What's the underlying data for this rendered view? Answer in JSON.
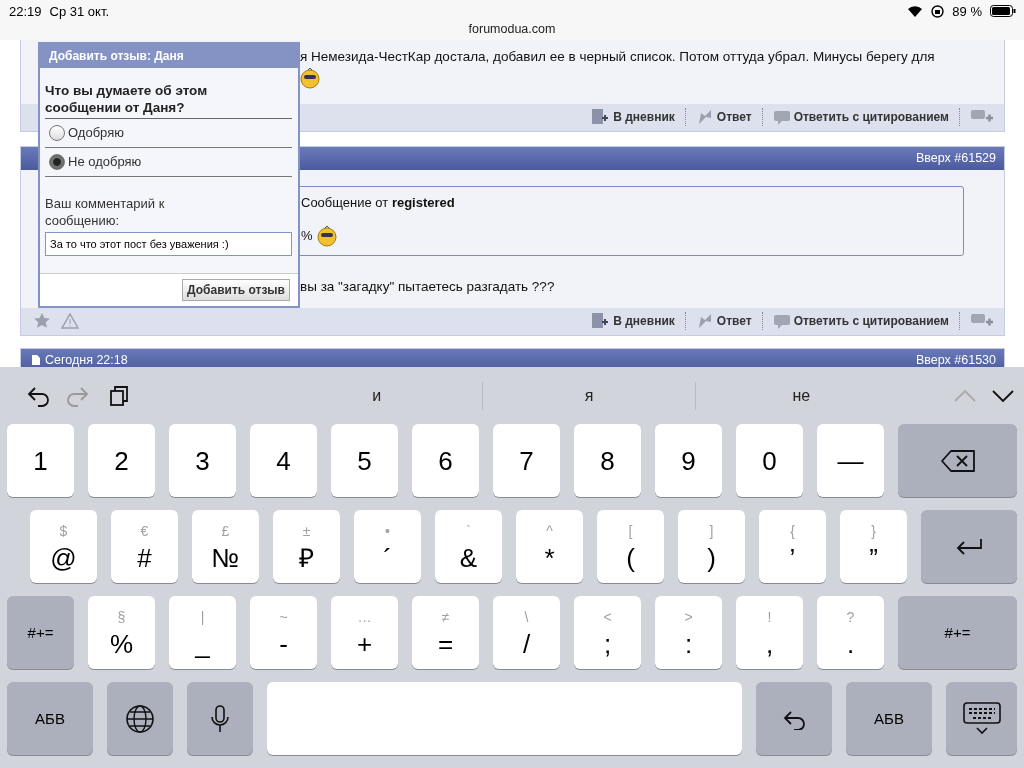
{
  "status_bar": {
    "time": "22:19",
    "date": "Ср 31 окт.",
    "battery": "89 %"
  },
  "address_bar": {
    "url": "forumodua.com"
  },
  "posts": [
    {
      "text": "я Немезида-ЧестКар достала, добавил ее в черный список. Потом оттуда убрал. Минусы берегу для",
      "smiley": true,
      "footer_left_icons": false,
      "actions": [
        "В дневник",
        "Ответ",
        "Ответить с цитированием"
      ]
    },
    {
      "header": {
        "link": "Вверх #61529"
      },
      "quote": {
        "title": "Сообщение от ",
        "author": "registered",
        "text": "%"
      },
      "text": "вы за \"загадку\" пытаетесь разгадать ???",
      "smiley": false,
      "footer_left_icons": true,
      "actions": [
        "В дневник",
        "Ответ",
        "Ответить с цитированием"
      ]
    },
    {
      "header": {
        "date": "Сегодня 22:18",
        "link": "Вверх #61530"
      }
    }
  ],
  "dialog": {
    "title": "Добавить отзыв: Даня",
    "question": "Что вы думаете об этом сообщении от Даня?",
    "options": [
      {
        "label": "Одобряю",
        "selected": false
      },
      {
        "label": "Не одобряю",
        "selected": true
      }
    ],
    "comment_label": "Ваш комментарий к сообщению:",
    "comment": "За то что этот пост без уважения :)",
    "submit": "Добавить отзыв"
  },
  "suggestions": [
    "и",
    "я",
    "не"
  ],
  "keyboard": [
    [
      {
        "kind": "char",
        "label": "1"
      },
      {
        "kind": "char",
        "label": "2"
      },
      {
        "kind": "char",
        "label": "3"
      },
      {
        "kind": "char",
        "label": "4"
      },
      {
        "kind": "char",
        "label": "5"
      },
      {
        "kind": "char",
        "label": "6"
      },
      {
        "kind": "char",
        "label": "7"
      },
      {
        "kind": "char",
        "label": "8"
      },
      {
        "kind": "char",
        "label": "9"
      },
      {
        "kind": "char",
        "label": "0"
      },
      {
        "kind": "char",
        "label": "—"
      },
      {
        "kind": "delete"
      }
    ],
    [
      {
        "kind": "char",
        "label": "@",
        "alt": "$"
      },
      {
        "kind": "char",
        "label": "#",
        "alt": "€"
      },
      {
        "kind": "char",
        "label": "№",
        "alt": "£"
      },
      {
        "kind": "char",
        "label": "₽",
        "alt": "±"
      },
      {
        "kind": "char",
        "label": "´",
        "alt": "•"
      },
      {
        "kind": "char",
        "label": "&",
        "alt": "`"
      },
      {
        "kind": "char",
        "label": "*",
        "alt": "^"
      },
      {
        "kind": "char",
        "label": "(",
        "alt": "["
      },
      {
        "kind": "char",
        "label": ")",
        "alt": "]"
      },
      {
        "kind": "char",
        "label": "’",
        "alt": "{"
      },
      {
        "kind": "char",
        "label": "”",
        "alt": "}"
      },
      {
        "kind": "return"
      }
    ],
    [
      {
        "kind": "function",
        "label": "#+="
      },
      {
        "kind": "char",
        "label": "%",
        "alt": "§"
      },
      {
        "kind": "char",
        "label": "_",
        "alt": "|"
      },
      {
        "kind": "char",
        "label": "-",
        "alt": "~"
      },
      {
        "kind": "char",
        "label": "+",
        "alt": "…"
      },
      {
        "kind": "char",
        "label": "=",
        "alt": "≠"
      },
      {
        "kind": "char",
        "label": "/",
        "alt": "\\"
      },
      {
        "kind": "char",
        "label": ";",
        "alt": "<"
      },
      {
        "kind": "char",
        "label": ":",
        "alt": ">"
      },
      {
        "kind": "char",
        "label": ",",
        "alt": "!"
      },
      {
        "kind": "char",
        "label": ".",
        "alt": "?"
      },
      {
        "kind": "function",
        "label": "#+="
      }
    ],
    [
      {
        "kind": "function",
        "label": "АБВ"
      },
      {
        "kind": "globe"
      },
      {
        "kind": "mic"
      },
      {
        "kind": "space"
      },
      {
        "kind": "undo"
      },
      {
        "kind": "function",
        "label": "АБВ"
      },
      {
        "kind": "hide"
      }
    ]
  ]
}
